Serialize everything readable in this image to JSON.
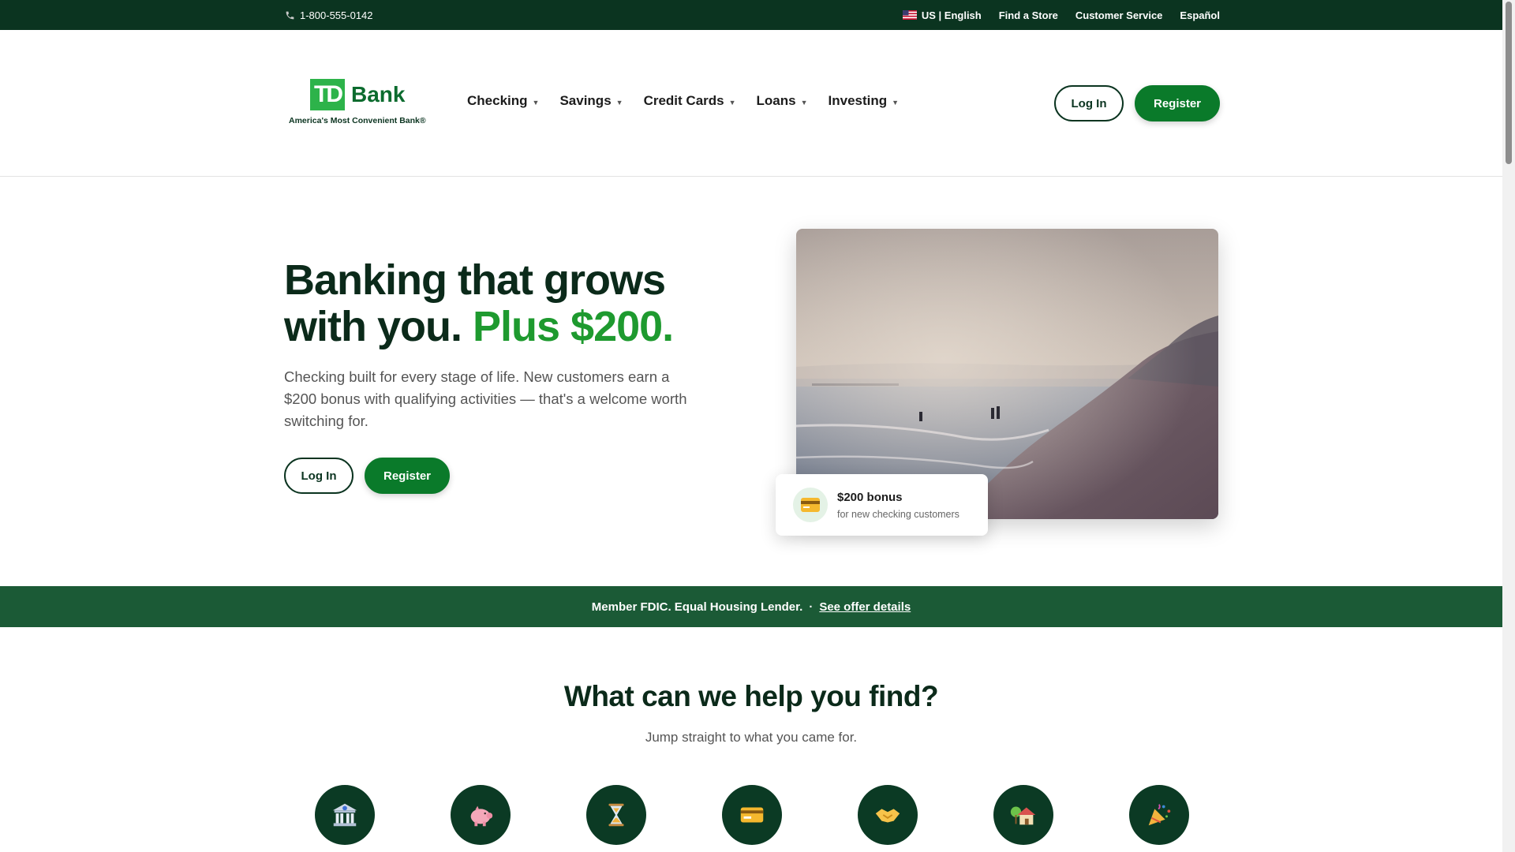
{
  "utility": {
    "phone": "1-800-555-0142",
    "language": "US | English",
    "find_store": "Find a Store",
    "customer_service": "Customer Service",
    "espanol": "Español"
  },
  "header": {
    "logo_mark": "TD",
    "logo_name": "Bank",
    "logo_tagline": "America's Most Convenient Bank®",
    "nav": [
      {
        "label": "Checking"
      },
      {
        "label": "Savings"
      },
      {
        "label": "Credit Cards"
      },
      {
        "label": "Loans"
      },
      {
        "label": "Investing"
      }
    ],
    "login_label": "Log In",
    "register_label": "Register"
  },
  "hero": {
    "title_line1": "Banking that grows",
    "title_line2": "with you.",
    "title_accent": "Plus $200.",
    "subtitle": "Checking built for every stage of life. New customers earn a $200 bonus with qualifying activities — that's a welcome worth switching for.",
    "login_label": "Log In",
    "register_label": "Register",
    "bonus_title": "$200 bonus",
    "bonus_sub": "for new checking customers"
  },
  "fdic": {
    "text": "Member FDIC. Equal Housing Lender.",
    "separator": "·",
    "link": "See offer details"
  },
  "find": {
    "title": "What can we help you find?",
    "subtitle": "Jump straight to what you came for.",
    "icons": [
      "bank-icon",
      "piggy-bank-icon",
      "hourglass-icon",
      "credit-card-icon",
      "handshake-icon",
      "house-icon",
      "party-popper-icon"
    ]
  },
  "colors": {
    "brand_dark": "#0b3420",
    "brand_green": "#0a7a2a",
    "accent_green": "#1e9a2f",
    "fdic_bar": "#1b5a36",
    "logo_green": "#2db34a"
  }
}
